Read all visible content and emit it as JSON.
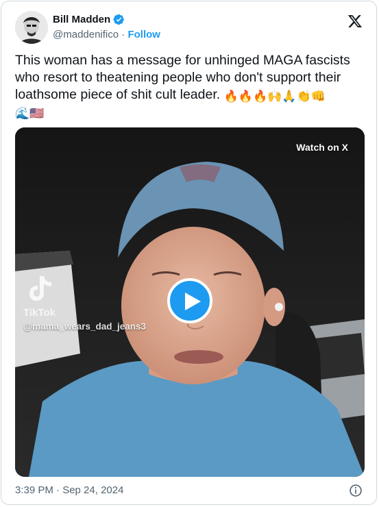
{
  "author": {
    "name": "Bill Madden",
    "handle": "@maddenifico",
    "separator": "·",
    "follow_label": "Follow",
    "verified": true
  },
  "tweet": {
    "text": "This woman has a message for unhinged MAGA fascists who resort to theatening people who don't support their loathsome piece of shit cult leader.",
    "emojis": [
      "🔥",
      "🔥",
      "🔥",
      "🙌",
      "🙏",
      "👏",
      "👊",
      "🌊",
      "🇺🇸"
    ]
  },
  "video": {
    "watch_label": "Watch on X",
    "watermark_brand": "TikTok",
    "watermark_user": "@mama_wears_dad_jeans3"
  },
  "footer": {
    "timestamp": "3:39 PM · Sep 24, 2024"
  },
  "colors": {
    "accent": "#1d9bf0",
    "text": "#0f1419",
    "muted": "#536471",
    "border": "#cfd9de"
  },
  "icons": [
    "verified-badge-icon",
    "x-logo-icon",
    "play-icon",
    "tiktok-icon",
    "info-icon"
  ]
}
